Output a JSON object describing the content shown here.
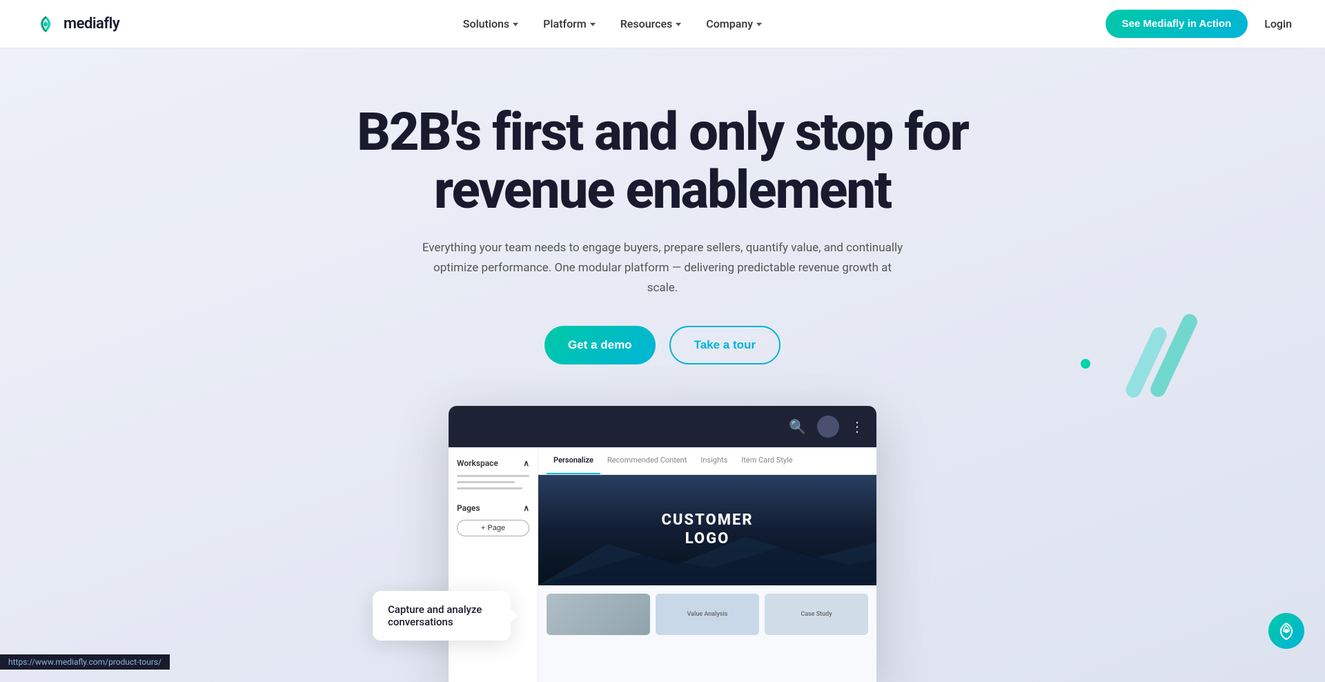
{
  "nav": {
    "logo_text": "mediafly",
    "links": [
      {
        "label": "Solutions",
        "has_dropdown": true
      },
      {
        "label": "Platform",
        "has_dropdown": true
      },
      {
        "label": "Resources",
        "has_dropdown": true
      },
      {
        "label": "Company",
        "has_dropdown": true
      }
    ],
    "cta_label": "See Mediafly in Action",
    "login_label": "Login"
  },
  "hero": {
    "title": "B2B's first and only stop for revenue enablement",
    "subtitle": "Everything your team needs to engage buyers, prepare sellers, quantify value, and continually optimize performance. One modular platform — delivering predictable revenue growth at scale.",
    "btn_demo": "Get a demo",
    "btn_tour": "Take a tour"
  },
  "mockup": {
    "tabs": [
      "Personalize",
      "Recommended Content",
      "Insights",
      "Item Card Style"
    ],
    "active_tab": "Personalize",
    "sidebar": {
      "workspace_label": "Workspace",
      "pages_label": "Pages",
      "add_page_label": "+ Page"
    },
    "customer_logo_line1": "CUSTOMER",
    "customer_logo_line2": "LOGO",
    "thumbnail_labels": [
      "",
      "Value Analysis",
      "Case Study"
    ]
  },
  "tooltip": {
    "text": "Capture and analyze conversations"
  },
  "bottom_right": {
    "icon_label": "mediafly-chat-icon"
  },
  "status_bar": {
    "url": "https://www.mediafly.com/product-tours/"
  }
}
